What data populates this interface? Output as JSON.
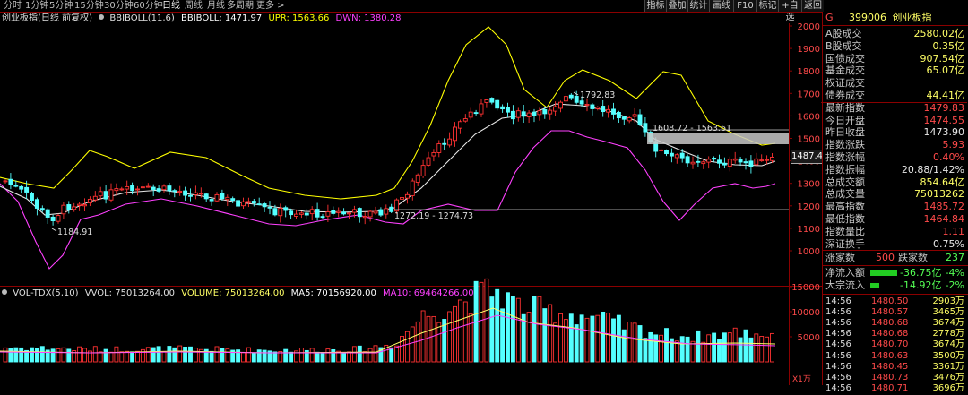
{
  "periods": [
    "分时",
    "1分钟",
    "5分钟",
    "15分钟",
    "30分钟",
    "60分钟",
    "日线",
    "周线",
    "月线",
    "多周期",
    "更多 >"
  ],
  "active_period": "日线",
  "toolbar": [
    "指标",
    "叠加",
    "统计",
    "画线",
    "F10",
    "标记",
    "+自选",
    "返回"
  ],
  "main_legend": {
    "name": "创业板指(日线 前复权)",
    "indicator": "BBIBOLL(11,6)",
    "bbiboll": "BBIBOLL: 1471.97",
    "upr": "UPR: 1563.66",
    "dwn": "DWN: 1380.28"
  },
  "price_axis": [
    "2000",
    "1900",
    "1800",
    "1700",
    "1600",
    "1500",
    "1400",
    "1300",
    "1200",
    "1100",
    "1000"
  ],
  "current_price_tag": "1487.4",
  "annotations": {
    "high": "1792.83",
    "low": "1184.91",
    "band_upper": "1608.72 - 1563.61",
    "band_lower": "1272.19 - 1274.73"
  },
  "vol_legend": {
    "name": "VOL-TDX(5,10)",
    "vvol": "VVOL: 75013264.00",
    "volume": "VOLUME: 75013264.00",
    "ma5": "MA5: 70156920.00",
    "ma10": "MA10: 69464266.00"
  },
  "vol_axis": [
    "15000",
    "10000",
    "5000"
  ],
  "vol_unit": "X1万",
  "colors": {
    "up": "#ff3232",
    "down": "#54ffff",
    "upr": "#ffff00",
    "dwn": "#ff40ff",
    "mid": "#e8e8e8"
  },
  "panel": {
    "marker": "G",
    "code": "399006",
    "name": "创业板指",
    "quotes": [
      {
        "label": "A股成交",
        "value": "2580.02亿",
        "color": "#ffff66"
      },
      {
        "label": "B股成交",
        "value": "0.35亿",
        "color": "#ffff66"
      },
      {
        "label": "国债成交",
        "value": "907.54亿",
        "color": "#ffff66"
      },
      {
        "label": "基金成交",
        "value": "65.07亿",
        "color": "#ffff66"
      },
      {
        "label": "权证成交",
        "value": "",
        "color": "#ffff66"
      },
      {
        "label": "债券成交",
        "value": "44.41亿",
        "color": "#ffff66"
      },
      {
        "label": "最新指数",
        "value": "1479.83",
        "color": "#ff4a4a"
      },
      {
        "label": "今日开盘",
        "value": "1474.55",
        "color": "#ff4a4a"
      },
      {
        "label": "昨日收盘",
        "value": "1473.90",
        "color": "#e8e8e8"
      },
      {
        "label": "指数涨跌",
        "value": "5.93",
        "color": "#ff4a4a"
      },
      {
        "label": "指数涨幅",
        "value": "0.40%",
        "color": "#ff4a4a"
      },
      {
        "label": "指数振幅",
        "value": "20.88/1.42%",
        "color": "#e8e8e8"
      },
      {
        "label": "总成交额",
        "value": "854.64亿",
        "color": "#ffff66"
      },
      {
        "label": "总成交量",
        "value": "75013262",
        "color": "#ffff66"
      },
      {
        "label": "最高指数",
        "value": "1485.72",
        "color": "#ff4a4a"
      },
      {
        "label": "最低指数",
        "value": "1464.84",
        "color": "#ff4a4a"
      },
      {
        "label": "指数量比",
        "value": "1.11",
        "color": "#ff4a4a"
      },
      {
        "label": "深证换手",
        "value": "0.75%",
        "color": "#e8e8e8"
      }
    ],
    "rise_label": "涨家数",
    "rise_value": "500",
    "fall_label": "跌家数",
    "fall_value": "237",
    "flows": [
      {
        "label": "净流入额",
        "value": "-36.75亿",
        "pct": "-4%"
      },
      {
        "label": "大宗流入",
        "value": "-14.92亿",
        "pct": "-2%"
      }
    ],
    "ticks": [
      {
        "time": "14:56",
        "price": "1480.50",
        "vol": "2903万"
      },
      {
        "time": "14:56",
        "price": "1480.57",
        "vol": "3465万"
      },
      {
        "time": "14:56",
        "price": "1480.68",
        "vol": "3674万"
      },
      {
        "time": "14:56",
        "price": "1480.68",
        "vol": "2778万"
      },
      {
        "time": "14:56",
        "price": "1480.70",
        "vol": "3674万"
      },
      {
        "time": "14:56",
        "price": "1480.63",
        "vol": "3500万"
      },
      {
        "time": "14:56",
        "price": "1480.45",
        "vol": "3361万"
      },
      {
        "time": "14:56",
        "price": "1480.73",
        "vol": "3476万"
      },
      {
        "time": "14:56",
        "price": "1480.71",
        "vol": "3696万"
      }
    ]
  }
}
